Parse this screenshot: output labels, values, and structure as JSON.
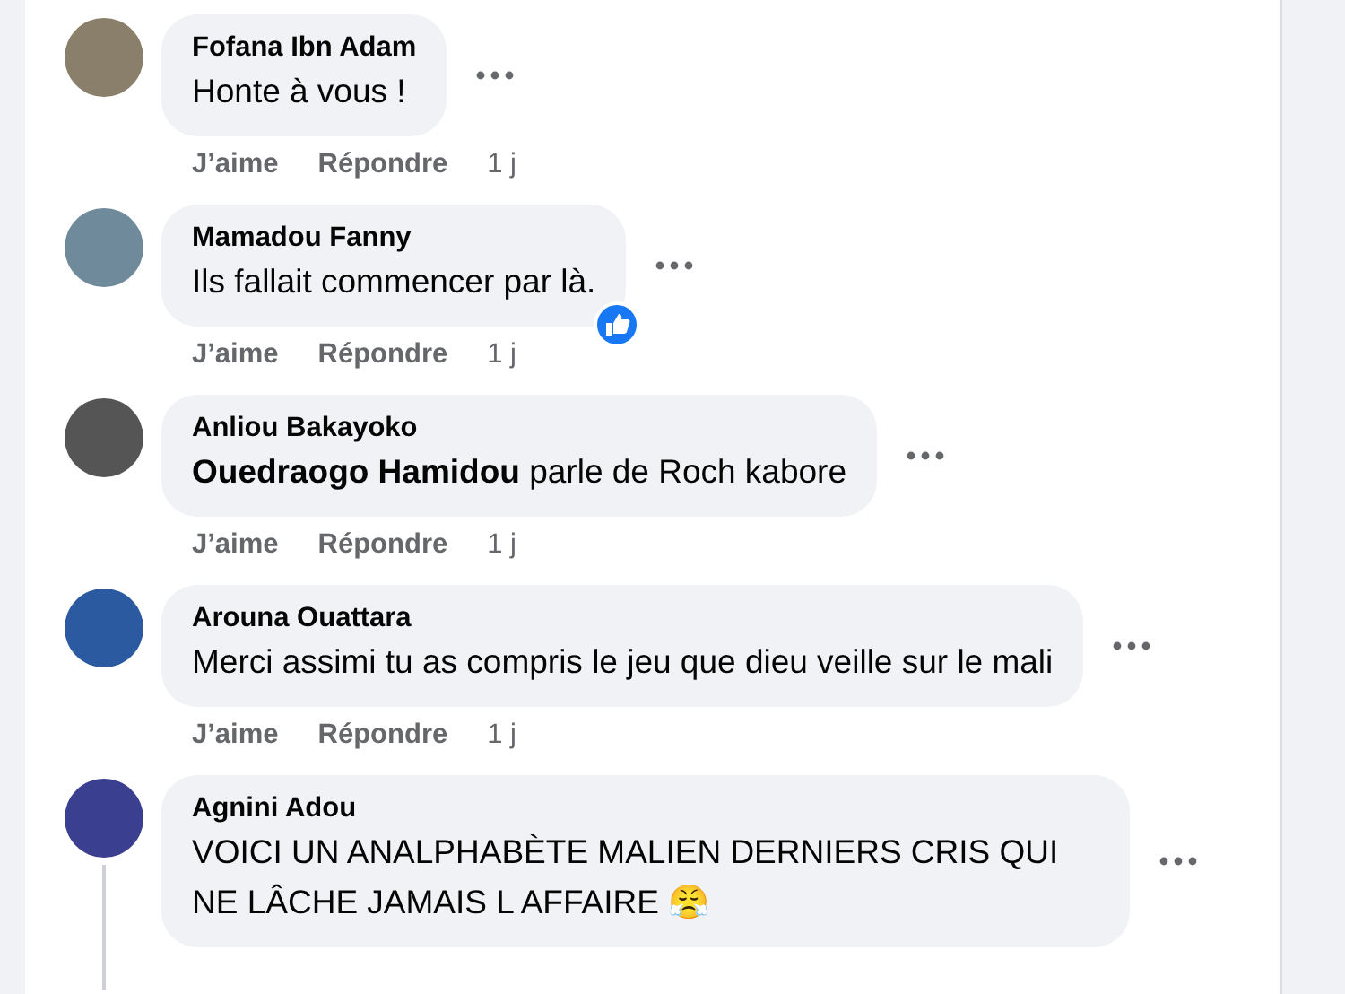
{
  "comments": [
    {
      "author": "Fofana Ibn Adam",
      "text": "Honte à vous !",
      "reacted": false,
      "actions": {
        "like": "J’aime",
        "reply": "Répondre",
        "time": "1 j"
      }
    },
    {
      "author": "Mamadou Fanny",
      "text": "Ils fallait commencer par là.",
      "reacted": true,
      "actions": {
        "like": "J’aime",
        "reply": "Répondre",
        "time": "1 j"
      }
    },
    {
      "author": "Anliou Bakayoko",
      "text": "**Ouedraogo Hamidou** parle de Roch kabore",
      "reacted": false,
      "actions": {
        "like": "J’aime",
        "reply": "Répondre",
        "time": "1 j"
      }
    },
    {
      "author": "Arouna Ouattara",
      "text": "Merci assimi tu as compris le jeu que dieu veille sur le mali",
      "reacted": false,
      "actions": {
        "like": "J’aime",
        "reply": "Répondre",
        "time": "1 j"
      }
    },
    {
      "author": "Agnini Adou",
      "text": "VOICI UN ANALPHABÈTE MALIEN DERNIERS CRIS QUI NE LÂCHE JAMAIS L AFFAIRE 😤",
      "reacted": false,
      "has_replies": true
    }
  ]
}
